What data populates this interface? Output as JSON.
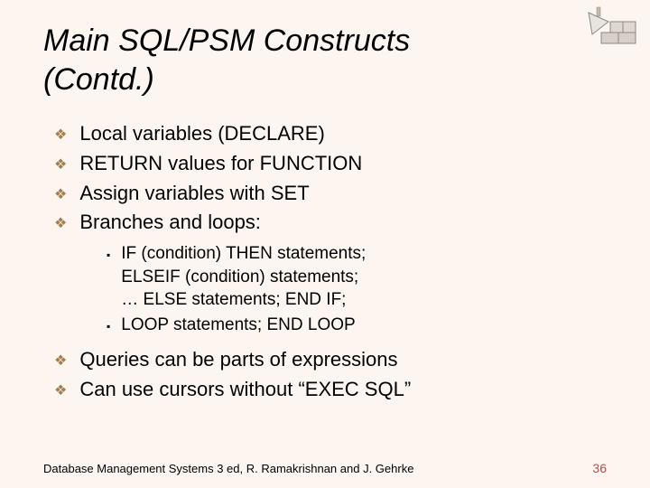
{
  "title_line1": "Main SQL/PSM Constructs",
  "title_line2": "(Contd.)",
  "bullets": {
    "b0": "Local variables (DECLARE)",
    "b1": "RETURN values for FUNCTION",
    "b2": "Assign variables with SET",
    "b3": "Branches and loops:",
    "b4": "Queries can be parts of expressions",
    "b5": "Can use cursors without “EXEC SQL”"
  },
  "sub": {
    "s0a": "IF (condition) THEN statements;",
    "s0b": "ELSEIF (condition) statements;",
    "s0c": "… ELSE statements; END IF;",
    "s1": "LOOP statements; END LOOP"
  },
  "footer": {
    "text": "Database Management Systems 3 ed,  R. Ramakrishnan and J. Gehrke",
    "page": "36"
  }
}
